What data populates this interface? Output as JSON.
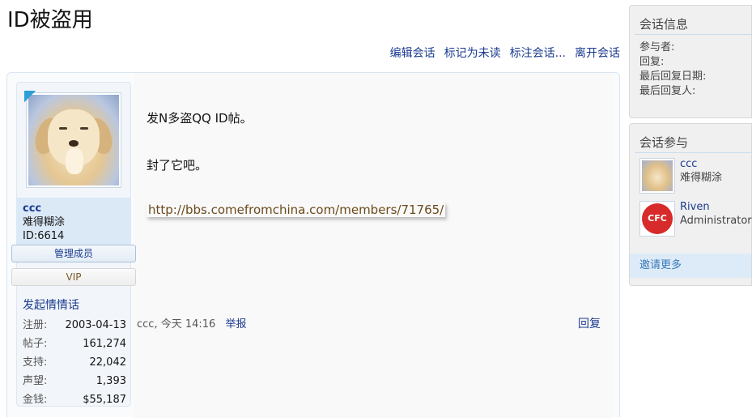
{
  "page": {
    "title": "ID被盗用"
  },
  "toolbar": {
    "edit": "编辑会话",
    "mark_unread": "标记为未读",
    "label": "标注会话...",
    "leave": "离开会话"
  },
  "post": {
    "lines": [
      "发N多盗QQ ID帖。",
      "封了它吧。"
    ],
    "link": "http://bbs.comefromchina.com/members/71765/",
    "author_time": "ccc, 今天 14:16",
    "report": "举报",
    "reply": "回复"
  },
  "user": {
    "name": "ccc",
    "title": "难得糊涂",
    "id": "ID:6614",
    "badges": [
      "管理成员",
      "VIP"
    ],
    "action": "发起情情话",
    "stats": [
      {
        "k": "注册:",
        "v": "2003-04-13"
      },
      {
        "k": "帖子:",
        "v": "161,274"
      },
      {
        "k": "支持:",
        "v": "22,042"
      },
      {
        "k": "声望:",
        "v": "1,393"
      },
      {
        "k": "金钱:",
        "v": "$55,187"
      }
    ]
  },
  "sidebar": {
    "info": {
      "heading": "会话信息",
      "rows": [
        "参与者:",
        "回复:",
        "最后回复日期:",
        "最后回复人:"
      ]
    },
    "participants": {
      "heading": "会话参与",
      "items": [
        {
          "name": "ccc",
          "role": "难得糊涂",
          "avatar": "puppy-avatar"
        },
        {
          "name": "Riven",
          "role": "Administrator",
          "avatar": "cfc-logo"
        }
      ],
      "invite": "邀请更多"
    }
  },
  "colors": {
    "link": "#1a3a8f",
    "accent": "#dcebf7",
    "cfc_red": "#d72a2a"
  }
}
